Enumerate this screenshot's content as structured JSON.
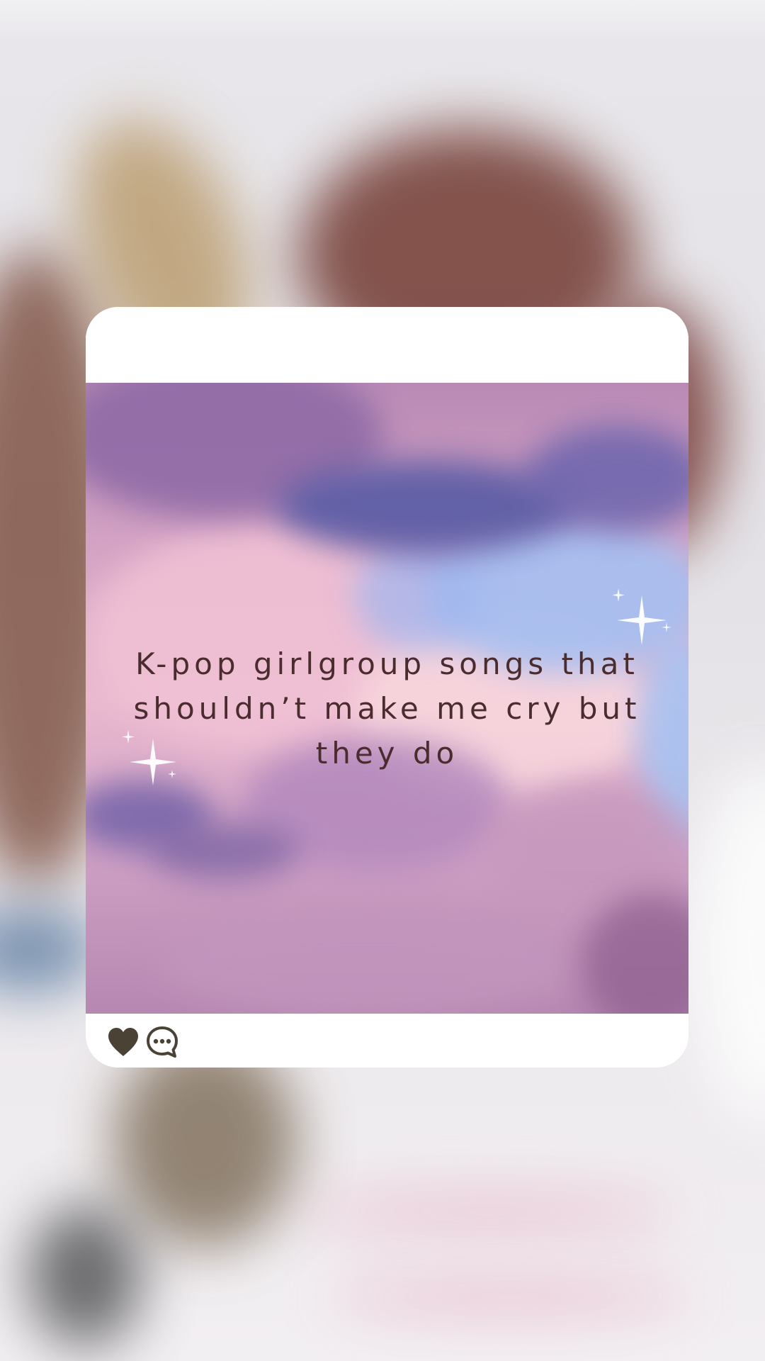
{
  "post": {
    "text": "K-pop girlgroup songs that shouldn’t make me cry but they do"
  },
  "actions": {
    "like_icon": "heart-icon",
    "comment_icon": "chat-bubble-icon"
  },
  "colors": {
    "text": "#4a2c2f",
    "icon": "#4b4236",
    "card": "#ffffff"
  }
}
